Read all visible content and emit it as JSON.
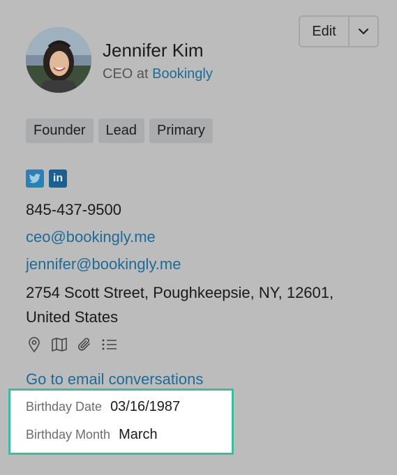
{
  "contact": {
    "name": "Jennifer Kim",
    "title_prefix": "CEO at",
    "company": "Bookingly"
  },
  "header_actions": {
    "edit_label": "Edit",
    "menu_icon": "chevron-down-icon"
  },
  "tags": [
    {
      "label": "Founder"
    },
    {
      "label": "Lead"
    },
    {
      "label": "Primary"
    }
  ],
  "social": {
    "twitter_icon": "twitter-icon",
    "linkedin_icon": "linkedin-icon",
    "linkedin_text": "in"
  },
  "details": {
    "phone": "845-437-9500",
    "emails": [
      "ceo@bookingly.me",
      "jennifer@bookingly.me"
    ],
    "address_line1": "2754 Scott Street, Poughkeepsie, NY, 12601,",
    "address_line2": "United States"
  },
  "action_icons": [
    "map-pin-icon",
    "map-icon",
    "paperclip-icon",
    "list-icon"
  ],
  "links": {
    "conversations": "Go to email conversations"
  },
  "custom_fields": {
    "birthday_date_label": "Birthday Date",
    "birthday_date_value": "03/16/1987",
    "birthday_month_label": "Birthday Month",
    "birthday_month_value": "March"
  },
  "colors": {
    "background": "#bcbcbc",
    "link": "#1f6a96",
    "highlight_border": "#3dbd9d",
    "tag_bg": "#abacad"
  }
}
